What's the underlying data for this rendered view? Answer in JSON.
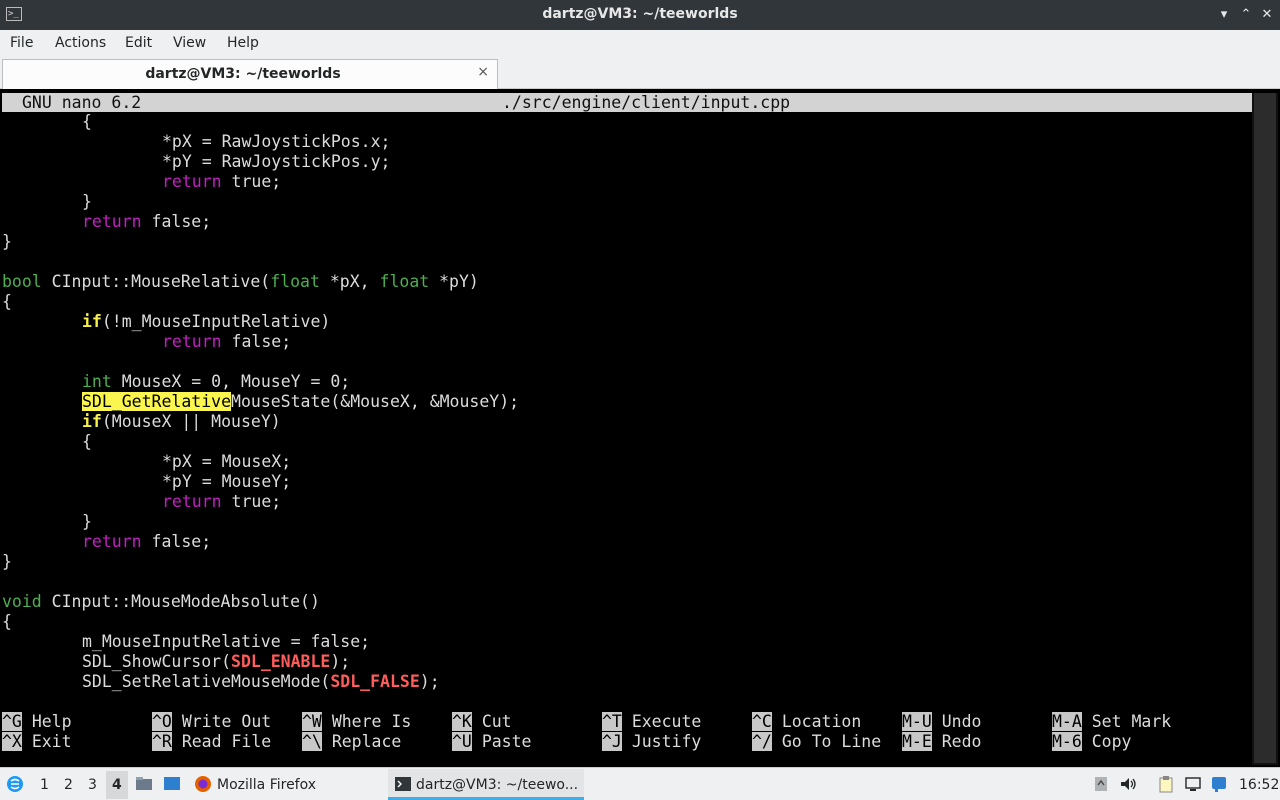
{
  "window": {
    "title": "dartz@VM3: ~/teeworlds",
    "minimize_glyph": "▾",
    "maximize_glyph": "⌃",
    "close_glyph": "✕",
    "icon": "terminal-icon"
  },
  "menu": [
    "File",
    "Actions",
    "Edit",
    "View",
    "Help"
  ],
  "tab": {
    "label": "dartz@VM3: ~/teeworlds",
    "close_glyph": "×"
  },
  "nano": {
    "version": "GNU nano 6.2",
    "filename": "./src/engine/client/input.cpp"
  },
  "code": {
    "l1": "\t{",
    "l2": "\t\t*pX = RawJoystickPos.x;",
    "l3": "\t\t*pY = RawJoystickPos.y;",
    "l4_kw": "return",
    "l4_rest": " true;",
    "l5": "\t}",
    "l6_kw": "return",
    "l6_rest": " false;",
    "l7": "}",
    "l9_kw": "bool",
    "l9_a": " CInput::MouseRelative(",
    "l9_kw2": "float",
    "l9_b": " *pX, ",
    "l9_kw3": "float",
    "l9_c": " *pY)",
    "l10": "{",
    "l11_kw": "if",
    "l11_rest": "(!m_MouseInputRelative)",
    "l12_kw": "return",
    "l12_rest": " false;",
    "l14_kw": "int",
    "l14_rest": " MouseX = 0, MouseY = 0;",
    "l15_hl": "SDL_GetRelative",
    "l15_rest": "MouseState(&MouseX, &MouseY);",
    "l16_kw": "if",
    "l16_rest": "(MouseX || MouseY)",
    "l17": "{",
    "l18": "*pX = MouseX;",
    "l19": "*pY = MouseY;",
    "l20_kw": "return",
    "l20_rest": " true;",
    "l21": "}",
    "l22_kw": "return",
    "l22_rest": " false;",
    "l23": "}",
    "l25_kw": "void",
    "l25_rest": " CInput::MouseModeAbsolute()",
    "l26": "{",
    "l27": "m_MouseInputRelative = false;",
    "l28_a": "SDL_ShowCursor(",
    "l28_const": "SDL_ENABLE",
    "l28_b": ");",
    "l29_a": "SDL_SetRelativeMouseMode(",
    "l29_const": "SDL_FALSE",
    "l29_b": ");"
  },
  "shortcuts": [
    {
      "key": "^G",
      "label": "Help"
    },
    {
      "key": "^O",
      "label": "Write Out"
    },
    {
      "key": "^W",
      "label": "Where Is"
    },
    {
      "key": "^K",
      "label": "Cut"
    },
    {
      "key": "^T",
      "label": "Execute"
    },
    {
      "key": "^C",
      "label": "Location"
    },
    {
      "key": "M-U",
      "label": "Undo"
    },
    {
      "key": "M-A",
      "label": "Set Mark"
    },
    {
      "key": "^X",
      "label": "Exit"
    },
    {
      "key": "^R",
      "label": "Read File"
    },
    {
      "key": "^\\",
      "label": "Replace"
    },
    {
      "key": "^U",
      "label": "Paste"
    },
    {
      "key": "^J",
      "label": "Justify"
    },
    {
      "key": "^/",
      "label": "Go To Line"
    },
    {
      "key": "M-E",
      "label": "Redo"
    },
    {
      "key": "M-6",
      "label": "Copy"
    }
  ],
  "taskbar": {
    "workspaces": [
      "1",
      "2",
      "3",
      "4"
    ],
    "active_workspace": "4",
    "tasks": [
      {
        "label": "Mozilla Firefox",
        "icon": "firefox-icon"
      },
      {
        "label": "dartz@VM3: ~/teewo...",
        "icon": "terminal-icon"
      }
    ],
    "clock": "16:52"
  },
  "colors": {
    "keyword": "#4caf50",
    "flow": "#c51ec5",
    "control": "#f7ef4a",
    "constant": "#ff5c5c",
    "highlight": "#fbf64f",
    "task_active": "#3daee9"
  }
}
